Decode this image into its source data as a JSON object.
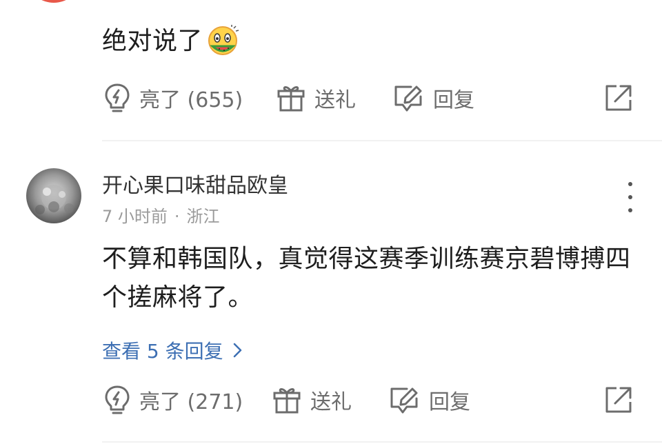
{
  "comment_top": {
    "text": "绝对说了",
    "emoji": "watermelon-eating-face-emoji",
    "actions": {
      "like_label": "亮了 (655)",
      "gift_label": "送礼",
      "reply_label": "回复"
    }
  },
  "comment_main": {
    "username": "开心果口味甜品欧皇",
    "time": "7 小时前",
    "separator": "·",
    "location": "浙江",
    "text": "不算和韩国队，真觉得这赛季训练赛京碧博搏四个搓麻将了。",
    "view_replies": "查看 5 条回复",
    "actions": {
      "like_label": "亮了 (271)",
      "gift_label": "送礼",
      "reply_label": "回复"
    }
  },
  "colors": {
    "text_main": "#1e1e1e",
    "text_secondary": "#6c6c6c",
    "meta": "#9a9a9a",
    "link": "#3d6fb3",
    "divider": "#f1f1f1"
  },
  "icons": [
    "lightbulb-icon",
    "gift-icon",
    "reply-edit-icon",
    "share-icon",
    "more-vertical-icon",
    "chevron-right-icon"
  ]
}
